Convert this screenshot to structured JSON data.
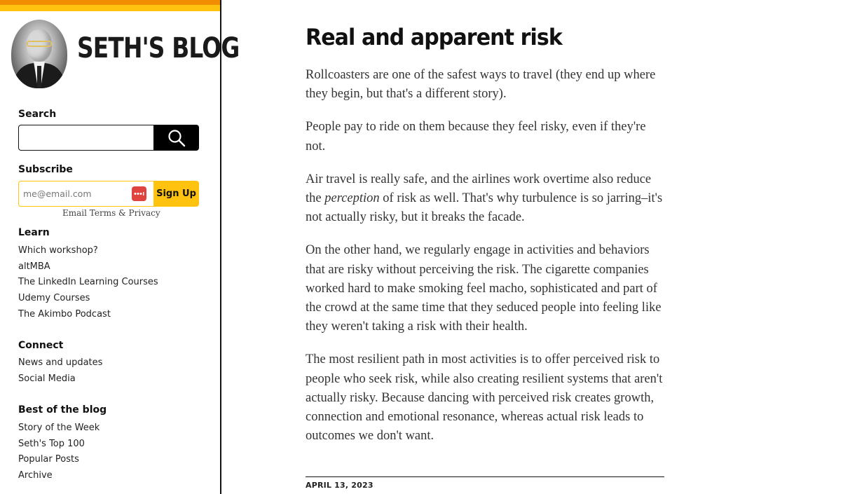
{
  "colors": {
    "stripe_orange": "#f28c00",
    "stripe_yellow": "#ffc20e",
    "signup_bg": "#ffc20e",
    "search_button_bg": "#000000",
    "password_manager_icon": "#e0443e"
  },
  "sidebar": {
    "brand_title": "SETH'S BLOG",
    "search": {
      "label": "Search",
      "placeholder": "",
      "value": "",
      "button_icon": "magnifier-icon"
    },
    "subscribe": {
      "label": "Subscribe",
      "email_placeholder": "me@email.com",
      "signup_label": "Sign Up",
      "terms_link": "Email Terms & Privacy",
      "password_icon": "password-manager-icon"
    },
    "learn": {
      "heading": "Learn",
      "items": [
        "Which workshop?",
        "altMBA",
        "The LinkedIn Learning Courses",
        "Udemy Courses",
        "The Akimbo Podcast"
      ]
    },
    "connect": {
      "heading": "Connect",
      "items": [
        "News and updates",
        "Social Media"
      ]
    },
    "best": {
      "heading": "Best of the blog",
      "items": [
        "Story of the Week",
        "Seth's Top 100",
        "Popular Posts",
        "Archive"
      ]
    }
  },
  "article": {
    "title": "Real and apparent risk",
    "p1": "Rollcoasters are one of the safest ways to travel (they end up where they begin, but that's a different story).",
    "p2": "People pay to ride on them because they feel risky, even if they're not.",
    "p3_before": "Air travel is really safe, and the airlines work overtime also reduce the ",
    "p3_em": "perception",
    "p3_after": " of risk as well. That's why turbulence is so jarring–it's not actually risky, but it breaks the facade.",
    "p4": "On the other hand, we regularly engage in activities and behaviors that are risky without perceiving the risk. The cigarette companies worked hard to make smoking feel macho, sophisticated and part of the crowd at the same time that they seduced people into feeling like they weren't taking a risk with their health.",
    "p5": "The most resilient path in most activities is to offer perceived risk to people who seek risk, while also creating resilient systems that aren't actually risky. Because dancing with perceived risk creates growth, connection and emotional resonance, whereas actual risk leads to outcomes we don't want.",
    "date": "APRIL 13, 2023"
  }
}
